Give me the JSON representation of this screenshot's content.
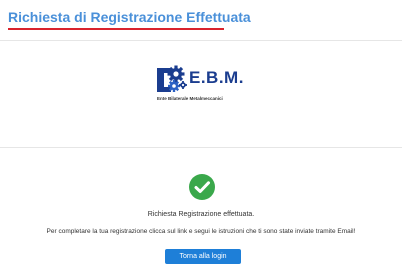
{
  "header": {
    "title": "Richiesta di Registrazione Effettuata",
    "accent_color": "#d9232d",
    "title_color": "#4a90d9"
  },
  "logo": {
    "icon": "gears-icon",
    "text": "E.B.M.",
    "subtitle": "Ente Bilaterale Metalmeccanici",
    "brand_color": "#1b3d8f"
  },
  "confirmation": {
    "icon": "checkmark-icon",
    "icon_color": "#3aa84b",
    "title": "Richiesta Registrazione effettuata.",
    "message": "Per completare la tua registrazione clicca sul link e segui le istruzioni che ti sono state inviate tramite Email!",
    "button_label": "Torna alla login",
    "button_color": "#1e7fd8"
  }
}
